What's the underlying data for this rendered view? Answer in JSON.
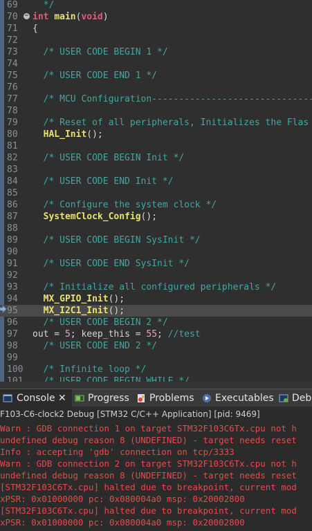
{
  "editor": {
    "lines": [
      {
        "n": "69",
        "tokens": [
          [
            "comment",
            "  */"
          ]
        ]
      },
      {
        "n": "70",
        "fold": true,
        "tokens": [
          [
            "kw",
            "int"
          ],
          [
            "plain",
            " "
          ],
          [
            "fn",
            "main"
          ],
          [
            "plain",
            "("
          ],
          [
            "kw",
            "void"
          ],
          [
            "plain",
            ")"
          ]
        ]
      },
      {
        "n": "71",
        "tokens": [
          [
            "plain",
            "{"
          ]
        ]
      },
      {
        "n": "72",
        "tokens": []
      },
      {
        "n": "73",
        "tokens": [
          [
            "comment",
            "  /* USER CODE BEGIN 1 */"
          ]
        ]
      },
      {
        "n": "74",
        "tokens": []
      },
      {
        "n": "75",
        "tokens": [
          [
            "comment",
            "  /* USER CODE END 1 */"
          ]
        ]
      },
      {
        "n": "76",
        "tokens": []
      },
      {
        "n": "77",
        "tokens": [
          [
            "comment",
            "  /* MCU Configuration--------------------------------"
          ]
        ]
      },
      {
        "n": "78",
        "tokens": []
      },
      {
        "n": "79",
        "tokens": [
          [
            "comment",
            "  /* Reset of all peripherals, Initializes the Flas"
          ]
        ]
      },
      {
        "n": "80",
        "tokens": [
          [
            "plain",
            "  "
          ],
          [
            "fn",
            "HAL_Init"
          ],
          [
            "plain",
            "();"
          ]
        ]
      },
      {
        "n": "81",
        "tokens": []
      },
      {
        "n": "82",
        "tokens": [
          [
            "comment",
            "  /* USER CODE BEGIN Init */"
          ]
        ]
      },
      {
        "n": "83",
        "tokens": []
      },
      {
        "n": "84",
        "tokens": [
          [
            "comment",
            "  /* USER CODE END Init */"
          ]
        ]
      },
      {
        "n": "85",
        "tokens": []
      },
      {
        "n": "86",
        "tokens": [
          [
            "comment",
            "  /* Configure the system clock */"
          ]
        ]
      },
      {
        "n": "87",
        "tokens": [
          [
            "plain",
            "  "
          ],
          [
            "fn",
            "SystemClock_Config"
          ],
          [
            "plain",
            "();"
          ]
        ]
      },
      {
        "n": "88",
        "tokens": []
      },
      {
        "n": "89",
        "tokens": [
          [
            "comment",
            "  /* USER CODE BEGIN SysInit */"
          ]
        ]
      },
      {
        "n": "90",
        "tokens": []
      },
      {
        "n": "91",
        "tokens": [
          [
            "comment",
            "  /* USER CODE END SysInit */"
          ]
        ]
      },
      {
        "n": "92",
        "tokens": []
      },
      {
        "n": "93",
        "tokens": [
          [
            "comment",
            "  /* Initialize all configured peripherals */"
          ]
        ]
      },
      {
        "n": "94",
        "tokens": [
          [
            "plain",
            "  "
          ],
          [
            "fn",
            "MX_GPIO_Init"
          ],
          [
            "plain",
            "();"
          ]
        ]
      },
      {
        "n": "95",
        "hl": true,
        "tokens": [
          [
            "plain",
            "  "
          ],
          [
            "fn",
            "MX_I2C1_Init"
          ],
          [
            "plain",
            "();"
          ]
        ]
      },
      {
        "n": "96",
        "tokens": [
          [
            "comment",
            "  /* USER CODE BEGIN 2 */"
          ]
        ]
      },
      {
        "n": "97",
        "tokens": [
          [
            "plain",
            "out = "
          ],
          [
            "num",
            "5"
          ],
          [
            "plain",
            "; keep_this = "
          ],
          [
            "num",
            "55"
          ],
          [
            "plain",
            "; "
          ],
          [
            "comment",
            "//test"
          ]
        ]
      },
      {
        "n": "98",
        "tokens": [
          [
            "comment",
            "  /* USER CODE END 2 */"
          ]
        ]
      },
      {
        "n": "99",
        "tokens": []
      },
      {
        "n": "100",
        "tokens": [
          [
            "comment",
            "  /* Infinite loop */"
          ]
        ]
      },
      {
        "n": "101",
        "tokens": [
          [
            "comment",
            "  /* USER CODE BEGIN WHILE */"
          ]
        ]
      }
    ]
  },
  "tabs": [
    {
      "label": "Console",
      "icon": "console-icon",
      "active": true,
      "close": "✕"
    },
    {
      "label": "Progress",
      "icon": "progress-icon"
    },
    {
      "label": "Problems",
      "icon": "problems-icon"
    },
    {
      "label": "Executables",
      "icon": "executables-icon"
    },
    {
      "label": "Debu",
      "icon": "debugger-console-icon"
    }
  ],
  "console": {
    "title": "F103-C6-clock2 Debug [STM32 C/C++ Application]  [pid: 9469]",
    "lines": [
      "Warn : GDB connection 1 on target STM32F103C6Tx.cpu not h",
      "undefined debug reason 8 (UNDEFINED) - target needs reset",
      "Info : accepting 'gdb' connection on tcp/3333",
      "Warn : GDB connection 2 on target STM32F103C6Tx.cpu not h",
      "undefined debug reason 8 (UNDEFINED) - target needs reset",
      "[STM32F103C6Tx.cpu] halted due to breakpoint, current mod",
      "xPSR: 0x01000000 pc: 0x080004a0 msp: 0x20002800",
      "[STM32F103C6Tx.cpu] halted due to breakpoint, current mod",
      "xPSR: 0x01000000 pc: 0x080004a0 msp: 0x20002800"
    ]
  },
  "colors": {
    "comment": "#43a6a1",
    "keyword": "#e05a7c",
    "function": "#e8e36a",
    "number": "#e8a2c8",
    "error_text": "#e8494b"
  }
}
